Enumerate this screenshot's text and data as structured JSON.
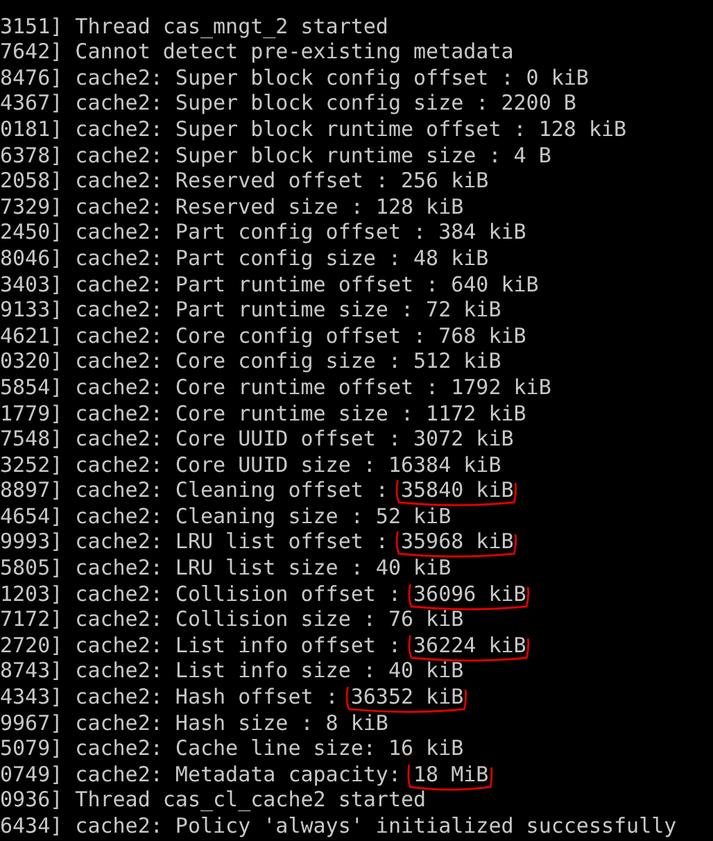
{
  "terminal": {
    "lines": [
      {
        "text": "3151] Thread cas_mngt_2 started",
        "circled": false
      },
      {
        "text": "7642] Cannot detect pre-existing metadata",
        "circled": false
      },
      {
        "text": "8476] cache2: Super block config offset : 0 kiB",
        "circled": false
      },
      {
        "text": "4367] cache2: Super block config size : 2200 B",
        "circled": false
      },
      {
        "text": "0181] cache2: Super block runtime offset : 128 kiB",
        "circled": false
      },
      {
        "text": "6378] cache2: Super block runtime size : 4 B",
        "circled": false
      },
      {
        "text": "2058] cache2: Reserved offset : 256 kiB",
        "circled": false
      },
      {
        "text": "7329] cache2: Reserved size : 128 kiB",
        "circled": false
      },
      {
        "text": "2450] cache2: Part config offset : 384 kiB",
        "circled": false
      },
      {
        "text": "8046] cache2: Part config size : 48 kiB",
        "circled": false
      },
      {
        "text": "3403] cache2: Part runtime offset : 640 kiB",
        "circled": false
      },
      {
        "text": "9133] cache2: Part runtime size : 72 kiB",
        "circled": false
      },
      {
        "text": "4621] cache2: Core config offset : 768 kiB",
        "circled": false
      },
      {
        "text": "0320] cache2: Core config size : 512 kiB",
        "circled": false
      },
      {
        "text": "5854] cache2: Core runtime offset : 1792 kiB",
        "circled": false
      },
      {
        "text": "1779] cache2: Core runtime size : 1172 kiB",
        "circled": false
      },
      {
        "text": "7548] cache2: Core UUID offset : 3072 kiB",
        "circled": false
      },
      {
        "text": "3252] cache2: Core UUID size : 16384 kiB",
        "circled": false
      },
      {
        "text": "8897] cache2: Cleaning offset : ",
        "value": "35840 kiB",
        "circled": true
      },
      {
        "text": "4654] cache2: Cleaning size : 52 kiB",
        "circled": false
      },
      {
        "text": "9993] cache2: LRU list offset : ",
        "value": "35968 kiB",
        "circled": true
      },
      {
        "text": "5805] cache2: LRU list size : 40 kiB",
        "circled": false
      },
      {
        "text": "1203] cache2: Collision offset : ",
        "value": "36096 kiB",
        "circled": true
      },
      {
        "text": "7172] cache2: Collision size : 76 kiB",
        "circled": false
      },
      {
        "text": "2720] cache2: List info offset : ",
        "value": "36224 kiB",
        "circled": true
      },
      {
        "text": "8743] cache2: List info size : 40 kiB",
        "circled": false
      },
      {
        "text": "4343] cache2: Hash offset : ",
        "value": "36352 kiB",
        "circled": true
      },
      {
        "text": "9967] cache2: Hash size : 8 kiB",
        "circled": false
      },
      {
        "text": "5079] cache2: Cache line size: 16 kiB",
        "circled": false
      },
      {
        "text": "0749] cache2: Metadata capacity: ",
        "value": "18 MiB",
        "circled": true
      },
      {
        "text": "0936] Thread cas_cl_cache2 started",
        "circled": false
      },
      {
        "text": "6434] cache2: Policy 'always' initialized successfully",
        "circled": false
      }
    ]
  }
}
